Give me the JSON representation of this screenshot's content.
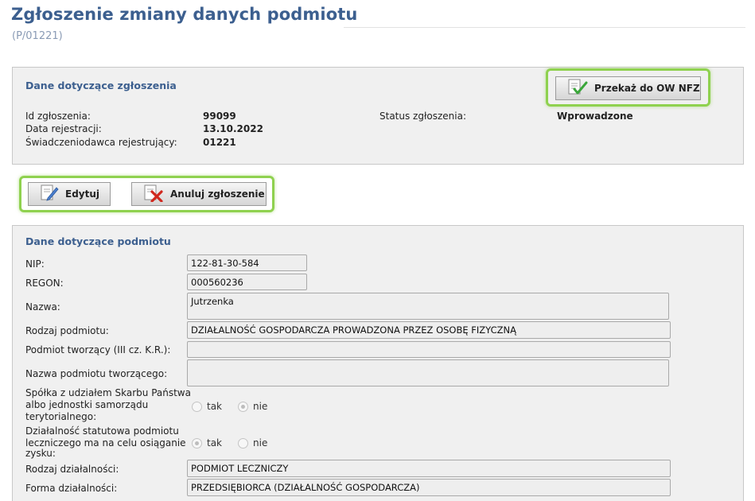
{
  "page": {
    "title": "Zgłoszenie zmiany danych podmiotu",
    "code": "(P/01221)"
  },
  "zgloszenie": {
    "title": "Dane dotyczące zgłoszenia",
    "id_label": "Id zgłoszenia:",
    "id_value": "99099",
    "date_label": "Data rejestracji:",
    "date_value": "13.10.2022",
    "provider_label": "Świadczeniodawca rejestrujący:",
    "provider_value": "01221",
    "status_label": "Status zgłoszenia:",
    "status_value": "Wprowadzone",
    "submit_button": "Przekaż do OW NFZ"
  },
  "actions": {
    "edit_button": "Edytuj",
    "cancel_button": "Anuluj zgłoszenie"
  },
  "podmiot": {
    "title": "Dane dotyczące podmiotu",
    "nip_label": "NIP:",
    "nip_value": "122-81-30-584",
    "regon_label": "REGON:",
    "regon_value": "000560236",
    "nazwa_label": "Nazwa:",
    "nazwa_value": "Jutrzenka",
    "rodzaj_label": "Rodzaj podmiotu:",
    "rodzaj_value": "DZIAŁALNOŚĆ GOSPODARCZA PROWADZONA PRZEZ OSOBĘ FIZYCZNĄ",
    "tworzacy_label": "Podmiot tworzący (III cz. K.R.):",
    "tworzacy_value": "",
    "nazwa_tworzacego_label": "Nazwa podmiotu tworzącego:",
    "nazwa_tworzacego_value": "",
    "spolka_label_1": "Spółka z udziałem Skarbu Państwa",
    "spolka_label_2": "albo jednostki samorządu",
    "spolka_label_3": "terytorialnego:",
    "spolka_tak": "tak",
    "spolka_nie": "nie",
    "zysk_label_1": "Działalność statutowa podmiotu",
    "zysk_label_2": "leczniczego ma na celu osiąganie",
    "zysk_label_3": "zysku:",
    "zysk_tak": "tak",
    "zysk_nie": "nie",
    "rodzaj_dzialalnosci_label": "Rodzaj działalności:",
    "rodzaj_dzialalnosci_value": "PODMIOT LECZNICZY",
    "forma_label": "Forma działalności:",
    "forma_value": "PRZEDSIĘBIORCA (DZIAŁALNOŚĆ GOSPODARCZA)"
  },
  "colors": {
    "heading": "#3c5f8f",
    "highlight": "#8fd14f",
    "panel_bg": "#f0f0f0"
  },
  "icons": {
    "submit": "document-check-icon",
    "edit": "document-edit-icon",
    "cancel": "document-delete-icon"
  }
}
